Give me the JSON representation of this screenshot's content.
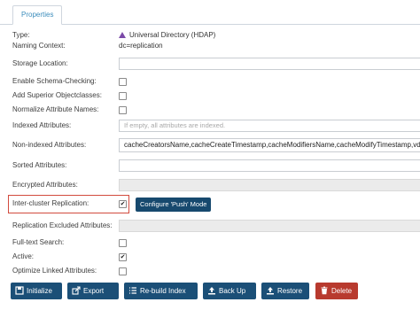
{
  "tabs": {
    "properties": "Properties"
  },
  "fields": {
    "type": {
      "label": "Type:",
      "value": "Universal Directory (HDAP)"
    },
    "naming_context": {
      "label": "Naming Context:",
      "value": "dc=replication"
    },
    "storage_location": {
      "label": "Storage Location:",
      "value": ""
    },
    "enable_schema_checking": {
      "label": "Enable Schema-Checking:",
      "checked": false
    },
    "add_superior_objectclasses": {
      "label": "Add Superior Objectclasses:",
      "checked": false
    },
    "normalize_attribute_names": {
      "label": "Normalize Attribute Names:",
      "checked": false
    },
    "indexed_attributes": {
      "label": "Indexed Attributes:",
      "placeholder": "If empty, all attributes are indexed."
    },
    "non_indexed_attributes": {
      "label": "Non-indexed Attributes:",
      "value": "cacheCreatorsName,cacheCreateTimestamp,cacheModifiersName,cacheModifyTimestamp,vd"
    },
    "sorted_attributes": {
      "label": "Sorted Attributes:",
      "value": ""
    },
    "encrypted_attributes": {
      "label": "Encrypted Attributes:",
      "value": ""
    },
    "inter_cluster_replication": {
      "label": "Inter-cluster Replication:",
      "checked": true,
      "configure_label": "Configure 'Push' Mode"
    },
    "replication_excluded_attributes": {
      "label": "Replication Excluded Attributes:",
      "value": ""
    },
    "full_text_search": {
      "label": "Full-text Search:",
      "checked": false
    },
    "active": {
      "label": "Active:",
      "checked": true
    },
    "optimize_linked_attributes": {
      "label": "Optimize Linked Attributes:",
      "checked": false
    }
  },
  "check_glyph": "✔",
  "actions": {
    "initialize": "Initialize",
    "export": "Export",
    "rebuild_index": "Re-build Index",
    "back_up": "Back Up",
    "restore": "Restore",
    "delete": "Delete"
  },
  "colors": {
    "primary": "#1b4f77",
    "danger": "#b83a2e",
    "highlight": "#d24b3e",
    "link": "#3c8dbc"
  }
}
